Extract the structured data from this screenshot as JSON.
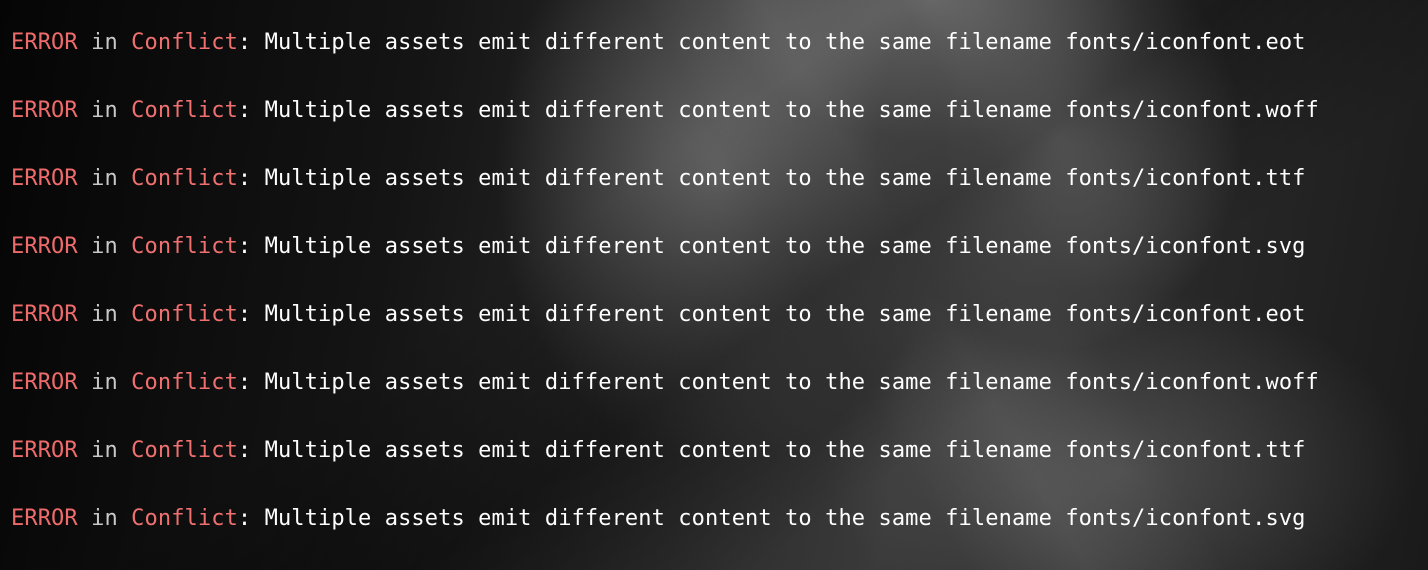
{
  "terminal": {
    "lines": [
      {
        "level": "ERROR",
        "in": "in",
        "source": "Conflict",
        "message": ": Multiple assets emit different content to the same filename fonts/iconfont.eot"
      },
      {
        "level": "ERROR",
        "in": "in",
        "source": "Conflict",
        "message": ": Multiple assets emit different content to the same filename fonts/iconfont.woff"
      },
      {
        "level": "ERROR",
        "in": "in",
        "source": "Conflict",
        "message": ": Multiple assets emit different content to the same filename fonts/iconfont.ttf"
      },
      {
        "level": "ERROR",
        "in": "in",
        "source": "Conflict",
        "message": ": Multiple assets emit different content to the same filename fonts/iconfont.svg"
      },
      {
        "level": "ERROR",
        "in": "in",
        "source": "Conflict",
        "message": ": Multiple assets emit different content to the same filename fonts/iconfont.eot"
      },
      {
        "level": "ERROR",
        "in": "in",
        "source": "Conflict",
        "message": ": Multiple assets emit different content to the same filename fonts/iconfont.woff"
      },
      {
        "level": "ERROR",
        "in": "in",
        "source": "Conflict",
        "message": ": Multiple assets emit different content to the same filename fonts/iconfont.ttf"
      },
      {
        "level": "ERROR",
        "in": "in",
        "source": "Conflict",
        "message": ": Multiple assets emit different content to the same filename fonts/iconfont.svg"
      }
    ]
  },
  "colors": {
    "error": "#ef6b6b",
    "source": "#f07070",
    "in": "#c8c8c8",
    "message": "#ffffff"
  }
}
